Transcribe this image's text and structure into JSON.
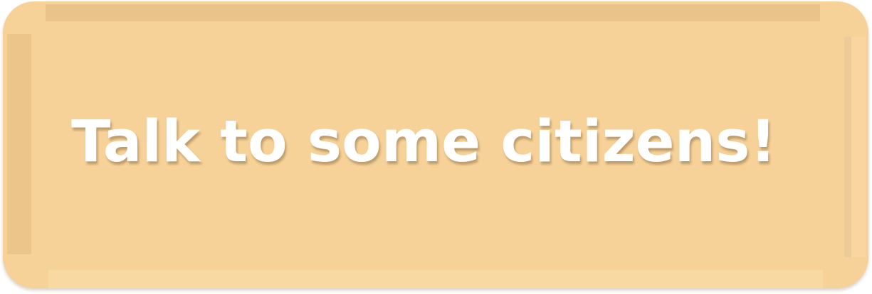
{
  "banner": {
    "message": "Talk to some citizens!"
  },
  "colors": {
    "banner_fill": "#f7d298",
    "text": "#ffffff"
  }
}
